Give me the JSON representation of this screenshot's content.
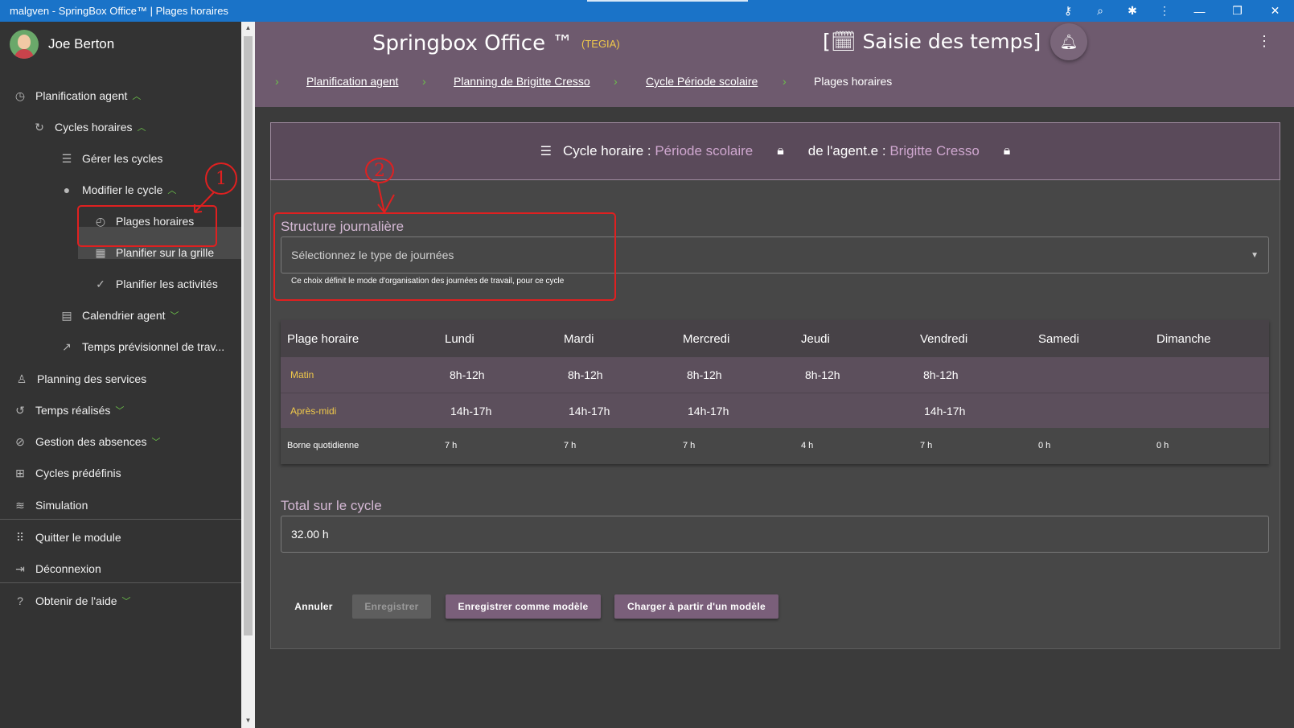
{
  "window": {
    "title": "malgven - SpringBox Office™ | Plages horaires"
  },
  "user": {
    "name": "Joe Berton"
  },
  "sidebar": {
    "items": [
      {
        "label": "Planification agent",
        "icon": "clock-icon",
        "chevron": "^"
      },
      {
        "label": "Cycles horaires",
        "icon": "cycle-icon",
        "chevron": "^"
      },
      {
        "label": "Gérer les cycles",
        "icon": "list-icon"
      },
      {
        "label": "Modifier le cycle",
        "icon": "edit-circle-icon",
        "chevron": "^"
      },
      {
        "label": "Plages horaires",
        "icon": "time-range-icon"
      },
      {
        "label": "Planifier sur la grille",
        "icon": "calendar-icon"
      },
      {
        "label": "Planifier les activités",
        "icon": "check-clock-icon"
      },
      {
        "label": "Calendrier agent",
        "icon": "stack-icon",
        "chevron": "v"
      },
      {
        "label": "Temps prévisionnel de trav...",
        "icon": "trend-icon"
      },
      {
        "label": "Planning des services",
        "icon": "person-icon"
      },
      {
        "label": "Temps réalisés",
        "icon": "history-icon",
        "chevron": "v"
      },
      {
        "label": "Gestion des absences",
        "icon": "person-off-icon",
        "chevron": "v"
      },
      {
        "label": "Cycles prédéfinis",
        "icon": "grid-icon"
      },
      {
        "label": "Simulation",
        "icon": "signal-icon"
      },
      {
        "label": "Quitter le module",
        "icon": "apps-icon"
      },
      {
        "label": "Déconnexion",
        "icon": "logout-icon"
      },
      {
        "label": "Obtenir de l'aide",
        "icon": "help-icon",
        "chevron": "v"
      }
    ]
  },
  "header": {
    "app_title": "Springbox Office ™",
    "org": "(TEGIA)",
    "page_title": "[🗓 Saisie des temps]",
    "breadcrumbs": [
      "Planification agent",
      "Planning de Brigitte Cresso",
      "Cycle Période scolaire",
      "Plages horaires"
    ]
  },
  "cycle_bar": {
    "cycle_label": "Cycle horaire : ",
    "cycle_value": "Période scolaire",
    "agent_label": "de l'agent.e : ",
    "agent_value": "Brigitte Cresso"
  },
  "structure": {
    "label": "Structure journalière",
    "placeholder": "Sélectionnez le type de journées",
    "hint": "Ce choix définit le mode d'organisation des journées de travail, pour ce cycle"
  },
  "table": {
    "columns": [
      "Plage horaire",
      "Lundi",
      "Mardi",
      "Mercredi",
      "Jeudi",
      "Vendredi",
      "Samedi",
      "Dimanche"
    ],
    "rows": [
      [
        "Matin",
        "8h-12h",
        "8h-12h",
        "8h-12h",
        "8h-12h",
        "8h-12h",
        "",
        ""
      ],
      [
        "Après-midi",
        "14h-17h",
        "14h-17h",
        "14h-17h",
        "",
        "14h-17h",
        "",
        ""
      ],
      [
        "Borne quotidienne",
        "7 h",
        "7 h",
        "7 h",
        "4 h",
        "7 h",
        "0 h",
        "0 h"
      ]
    ]
  },
  "total": {
    "label": "Total sur le cycle",
    "value": "32.00 h"
  },
  "buttons": {
    "cancel": "Annuler",
    "save": "Enregistrer",
    "save_model": "Enregistrer comme modèle",
    "load_model": "Charger à partir d'un modèle"
  },
  "annotations": {
    "one": "1",
    "two": "2"
  },
  "colors": {
    "titlebar": "#1a73c8",
    "header": "#6e5a6e",
    "accent": "#6cc24a",
    "annotation": "#e02020"
  }
}
